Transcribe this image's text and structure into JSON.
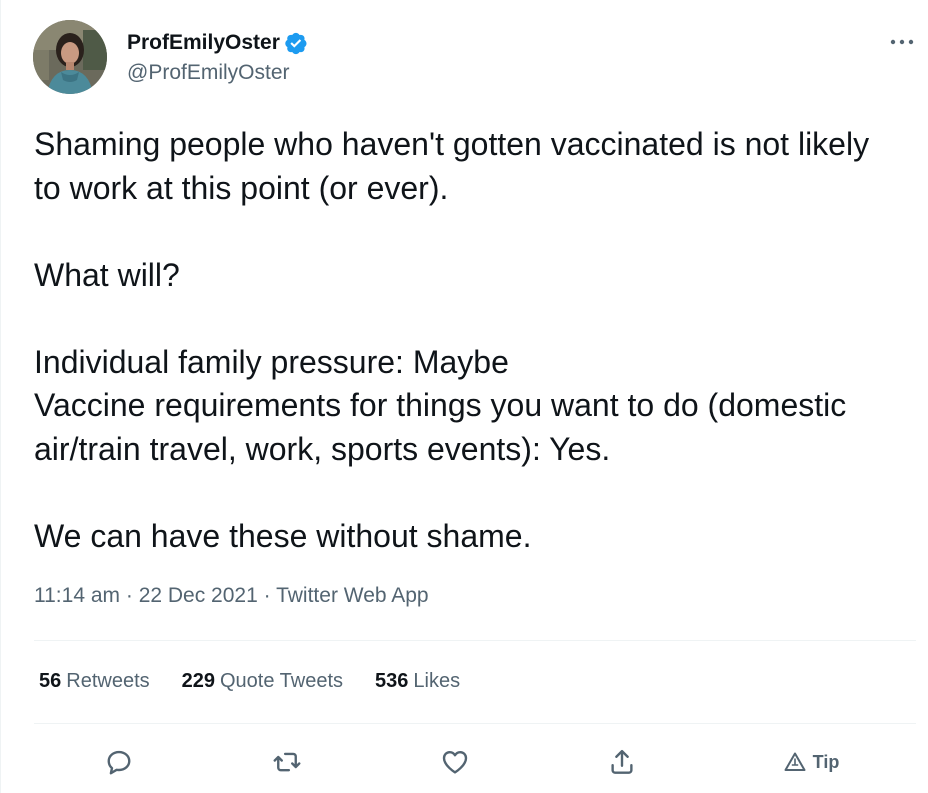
{
  "author": {
    "display_name": "ProfEmilyOster",
    "handle": "@ProfEmilyOster",
    "verified_icon": "verified-badge-icon",
    "accent_color": "#1d9bf0"
  },
  "tweet": {
    "text": "Shaming people who haven't gotten vaccinated is not likely to work at this point (or ever).\n\nWhat will?\n\nIndividual family pressure: Maybe\nVaccine requirements for things you want to do (domestic air/train travel, work, sports events): Yes.\n\nWe can have these without shame.",
    "time": "11:14 am",
    "date": "22 Dec 2021",
    "source": "Twitter Web App",
    "separator": "·"
  },
  "stats": {
    "retweets_count": "56",
    "retweets_label": "Retweets",
    "quotes_count": "229",
    "quotes_label": "Quote Tweets",
    "likes_count": "536",
    "likes_label": "Likes"
  },
  "actions": {
    "reply_icon": "reply-icon",
    "retweet_icon": "retweet-icon",
    "like_icon": "heart-icon",
    "share_icon": "share-icon",
    "tip_icon": "tip-icon",
    "tip_label": "Tip"
  },
  "colors": {
    "text": "#0f1419",
    "secondary": "#536471",
    "divider": "#eff3f4"
  }
}
